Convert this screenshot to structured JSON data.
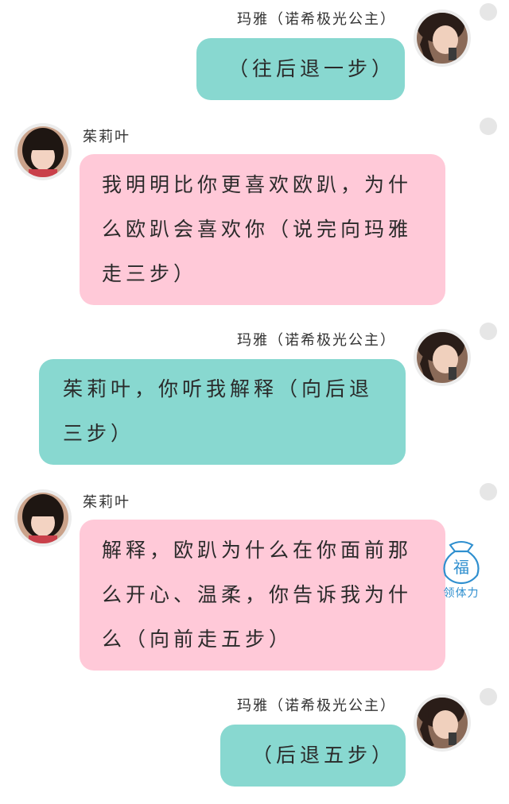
{
  "messages": [
    {
      "sender": "玛雅（诺希极光公主）",
      "side": "right",
      "color": "teal",
      "lines": [
        "（往后退一步）"
      ]
    },
    {
      "sender": "茱莉叶",
      "side": "left",
      "color": "pink",
      "lines": [
        "我明明比你更喜欢欧趴，为什",
        "么欧趴会喜欢你（说完向玛雅",
        "走三步）"
      ]
    },
    {
      "sender": "玛雅（诺希极光公主）",
      "side": "right",
      "color": "teal",
      "lines": [
        "茱莉叶，你听我解释（向后退",
        "三步）"
      ]
    },
    {
      "sender": "茱莉叶",
      "side": "left",
      "color": "pink",
      "lines": [
        "解释，欧趴为什么在你面前那",
        "么开心、温柔，你告诉我为什",
        "么（向前走五步）"
      ]
    },
    {
      "sender": "玛雅（诺希极光公主）",
      "side": "right",
      "color": "teal",
      "lines": [
        "（后退五步）"
      ]
    }
  ],
  "stamina_widget": {
    "glyph": "福",
    "label": "领体力",
    "icon": "fortune-bag-icon"
  },
  "colors": {
    "teal_bubble": "#88d8d0",
    "pink_bubble": "#ffc9d8",
    "accent": "#2f8fcf"
  }
}
